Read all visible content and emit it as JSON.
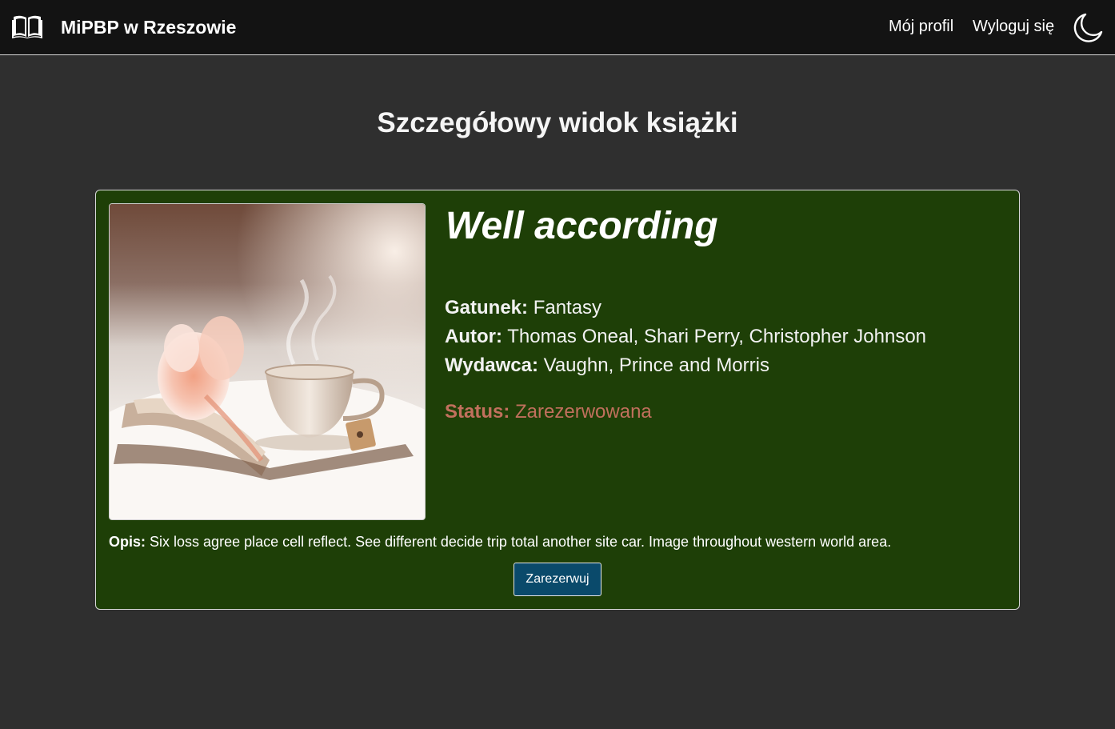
{
  "navbar": {
    "brand_icon": "open-book-icon",
    "brand_name": "MiPBP w Rzeszowie",
    "profile_label": "Mój profil",
    "logout_label": "Wyloguj się",
    "theme_icon": "moon-icon"
  },
  "page": {
    "title": "Szczegółowy widok książki"
  },
  "book": {
    "title": "Well according",
    "genre_label": "Gatunek:",
    "genre": "Fantasy",
    "author_label": "Autor:",
    "author": "Thomas Oneal, Shari Perry, Christopher Johnson",
    "publisher_label": "Wydawca:",
    "publisher": "Vaughn, Prince and Morris",
    "status_label": "Status:",
    "status": "Zarezerwowana",
    "description_label": "Opis:",
    "description": "Six loss agree place cell reflect. See different decide trip total another site car. Image throughout western world area.",
    "reserve_label": "Zarezerwuj"
  },
  "colors": {
    "navbar_bg": "#131313",
    "page_bg": "#2f2f2f",
    "card_bg": "#1e3f07",
    "status_color": "#c1705d",
    "button_bg": "#0a4a6b"
  }
}
